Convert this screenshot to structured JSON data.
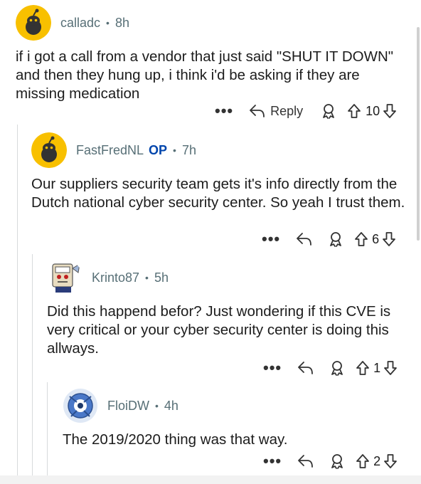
{
  "comments": [
    {
      "username": "calladc",
      "op": "",
      "time": "8h",
      "body": "if i got a call from a vendor that just said \"SHUT IT DOWN\" and then they hung up, i think i'd be asking if they are missing medication",
      "more": "•••",
      "reply": "Reply",
      "score": "10"
    },
    {
      "username": "FastFredNL",
      "op": "OP",
      "time": "7h",
      "body": "Our suppliers security team gets it's info directly from the Dutch national cyber security center. So yeah I trust them.",
      "more": "•••",
      "reply": "",
      "score": "6"
    },
    {
      "username": "Krinto87",
      "op": "",
      "time": "5h",
      "body": "Did this happend befor? Just wondering if this CVE is very critical or your cyber security center is doing this allways.",
      "more": "•••",
      "reply": "",
      "score": "1"
    },
    {
      "username": "FloiDW",
      "op": "",
      "time": "4h",
      "body": "The 2019/2020 thing was that way.",
      "more": "•••",
      "reply": "",
      "score": "2"
    }
  ],
  "separator": "•",
  "colors": {
    "avatar_yellow": "#f8c000",
    "op_blue": "#0045ac",
    "meta_gray": "#576f76",
    "thread_line": "#d7dadc"
  }
}
